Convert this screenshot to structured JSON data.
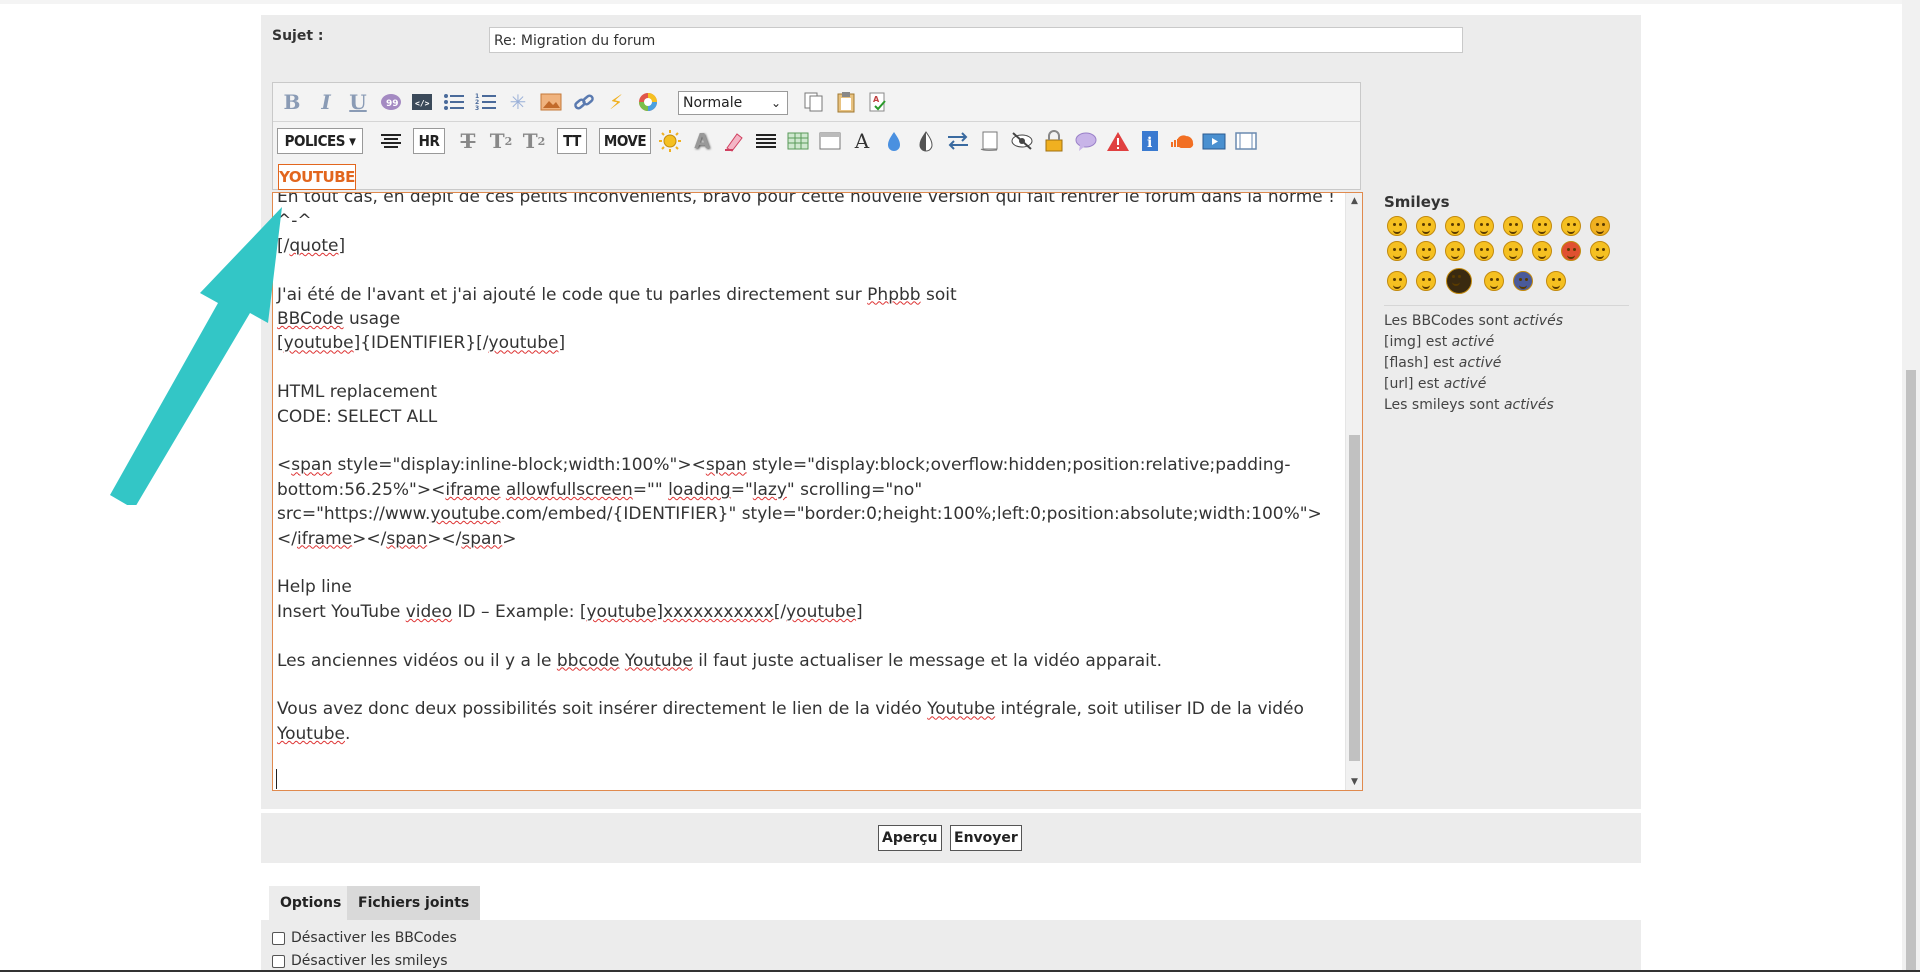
{
  "form": {
    "subject_label": "Sujet :",
    "subject_value": "Re: Migration du forum"
  },
  "toolbar": {
    "size_select": "Normale",
    "polices_button": "POLICES",
    "hr_button": "HR",
    "tt_button": "TT",
    "move_button": "MOVE",
    "youtube_button": "YOUTUBE"
  },
  "editor": {
    "lines": [
      "En tout cas, en dépit de ces petits inconvénients, bravo pour cette nouvelle version qui fait rentrer le forum dans la norme !",
      "^-^",
      "[/quote]",
      "",
      "J'ai été de l'avant et j'ai ajouté le code que tu parles directement sur Phpbb soit",
      "BBCode usage",
      "[youtube]{IDENTIFIER}[/youtube]",
      "",
      "HTML replacement",
      "CODE: SELECT ALL",
      "",
      "<span style=\"display:inline-block;width:100%\"><span style=\"display:block;overflow:hidden;position:relative;padding-",
      "bottom:56.25%\"><iframe allowfullscreen=\"\" loading=\"lazy\" scrolling=\"no\"",
      "src=\"https://www.youtube.com/embed/{IDENTIFIER}\" style=\"border:0;height:100%;left:0;position:absolute;width:100%\">",
      "</iframe></span></span>",
      "",
      "Help line",
      "Insert YouTube video ID – Example: [youtube]xxxxxxxxxxx[/youtube]",
      "",
      "Les anciennes vidéos ou il y a le bbcode Youtube il faut juste actualiser le message et la vidéo apparait.",
      "",
      "Vous avez donc deux possibilités soit insérer directement le lien de la vidéo Youtube intégrale, soit utiliser ID de la vidéo",
      "Youtube."
    ]
  },
  "sidebar": {
    "smileys_title": "Smileys",
    "info": [
      {
        "prefix": "Les BBCodes sont ",
        "state": "activés"
      },
      {
        "prefix": "[img] est ",
        "state": "activé"
      },
      {
        "prefix": "[flash] est ",
        "state": "activé"
      },
      {
        "prefix": "[url] est ",
        "state": "activé"
      },
      {
        "prefix": "Les smileys sont ",
        "state": "activés"
      }
    ]
  },
  "actions": {
    "preview": "Aperçu",
    "submit": "Envoyer"
  },
  "tabs": {
    "options": "Options",
    "attachments": "Fichiers joints"
  },
  "options": {
    "disable_bbcode": "Désactiver les BBCodes",
    "disable_smileys": "Désactiver les smileys"
  },
  "colors": {
    "accent": "#e2661e",
    "arrow": "#33c6c6",
    "panel": "#ececec"
  }
}
